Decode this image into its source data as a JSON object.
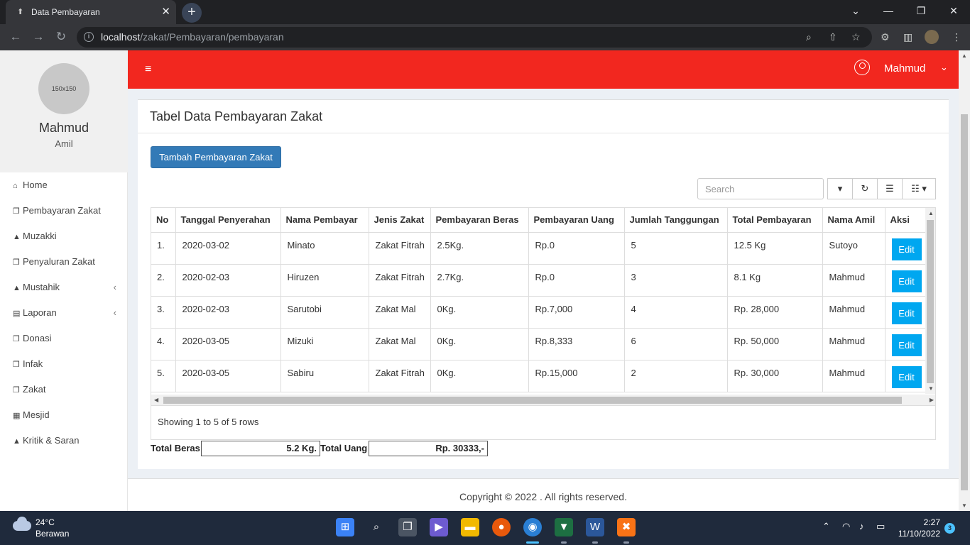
{
  "browser": {
    "tab_title": "Data Pembayaran",
    "url_host": "localhost",
    "url_path": "/zakat/Pembayaran/pembayaran"
  },
  "sidebar": {
    "avatar_text": "150x150",
    "user_name": "Mahmud",
    "user_role": "Amil",
    "items": [
      {
        "label": "Home",
        "icon": "home-icon",
        "has_caret": false
      },
      {
        "label": "Pembayaran Zakat",
        "icon": "copy-icon",
        "has_caret": false
      },
      {
        "label": "Muzakki",
        "icon": "user-icon",
        "has_caret": false
      },
      {
        "label": "Penyaluran Zakat",
        "icon": "copy-icon",
        "has_caret": false
      },
      {
        "label": "Mustahik",
        "icon": "users-icon",
        "has_caret": true
      },
      {
        "label": "Laporan",
        "icon": "print-icon",
        "has_caret": true
      },
      {
        "label": "Donasi",
        "icon": "copy-icon",
        "has_caret": false
      },
      {
        "label": "Infak",
        "icon": "copy-icon",
        "has_caret": false
      },
      {
        "label": "Zakat",
        "icon": "copy-icon",
        "has_caret": false
      },
      {
        "label": "Mesjid",
        "icon": "building-icon",
        "has_caret": false
      },
      {
        "label": "Kritik & Saran",
        "icon": "user-icon",
        "has_caret": false
      }
    ]
  },
  "topnav": {
    "user_name": "Mahmud"
  },
  "main": {
    "box_title": "Tabel Data Pembayaran Zakat",
    "add_button": "Tambah Pembayaran Zakat",
    "search_placeholder": "Search",
    "columns": [
      "No",
      "Tanggal Penyerahan",
      "Nama Pembayar",
      "Jenis Zakat",
      "Pembayaran Beras",
      "Pembayaran Uang",
      "Jumlah Tanggungan",
      "Total Pembayaran",
      "Nama Amil",
      "Aksi"
    ],
    "rows": [
      [
        "1.",
        "2020-03-02",
        "Minato",
        "Zakat Fitrah",
        "2.5Kg.",
        "Rp.0",
        "5",
        "12.5 Kg",
        "Sutoyo",
        "Edit"
      ],
      [
        "2.",
        "2020-02-03",
        "Hiruzen",
        "Zakat Fitrah",
        "2.7Kg.",
        "Rp.0",
        "3",
        "8.1 Kg",
        "Mahmud",
        "Edit"
      ],
      [
        "3.",
        "2020-02-03",
        "Sarutobi",
        "Zakat Mal",
        "0Kg.",
        "Rp.7,000",
        "4",
        "Rp. 28,000",
        "Mahmud",
        "Edit"
      ],
      [
        "4.",
        "2020-03-05",
        "Mizuki",
        "Zakat Mal",
        "0Kg.",
        "Rp.8,333",
        "6",
        "Rp. 50,000",
        "Mahmud",
        "Edit"
      ],
      [
        "5.",
        "2020-03-05",
        "Sabiru",
        "Zakat Fitrah",
        "0Kg.",
        "Rp.15,000",
        "2",
        "Rp. 30,000",
        "Mahmud",
        "Edit"
      ]
    ],
    "pagination_info": "Showing 1 to 5 of 5 rows",
    "total_beras_label": "Total Beras",
    "total_beras_value": "5.2 Kg.",
    "total_uang_label": "Total Uang",
    "total_uang_value": "Rp. 30333,-"
  },
  "footer": {
    "text": "Copyright © 2022 . All rights reserved."
  },
  "taskbar": {
    "temperature": "24°C",
    "condition": "Berawan",
    "time": "2:27",
    "date": "11/10/2022",
    "notification_count": "3"
  },
  "colors": {
    "topnav": "#f2271f",
    "primary_button": "#337ab7",
    "edit_button": "#00a7f0"
  }
}
